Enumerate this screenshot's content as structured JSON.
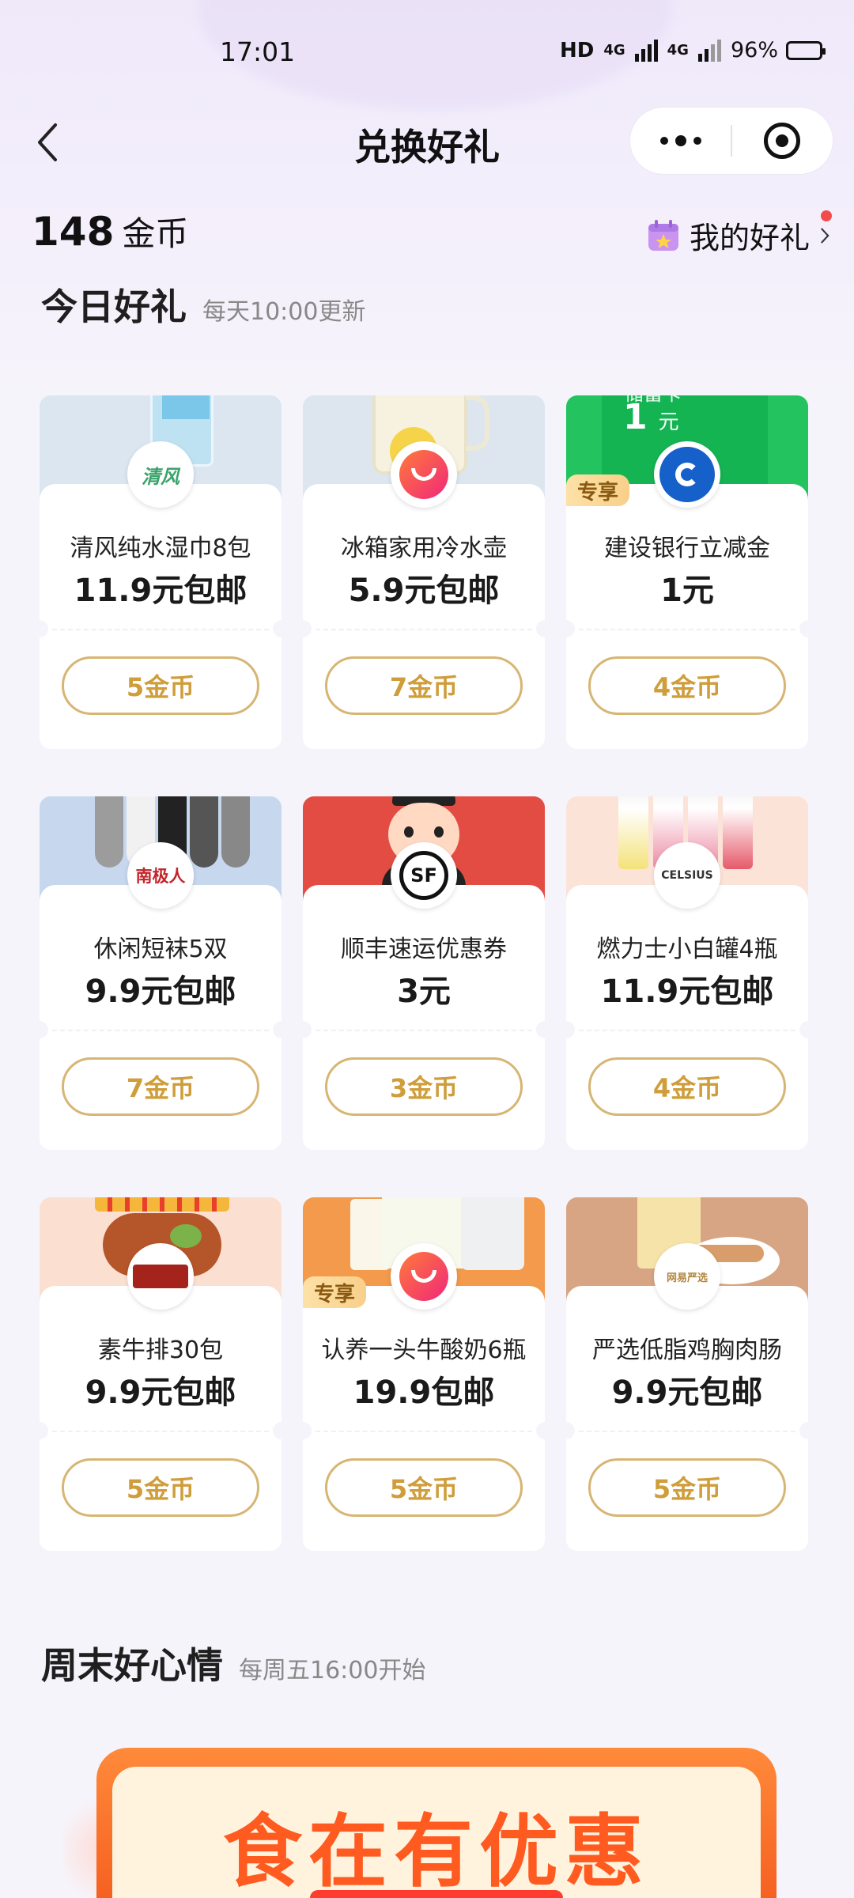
{
  "status": {
    "time": "17:01",
    "hd": "HD",
    "net1": "4G",
    "net2": "4G",
    "battery": "96%"
  },
  "nav": {
    "title": "兑换好礼"
  },
  "account": {
    "coins": "148",
    "coins_unit": "金币",
    "my_gifts": "我的好礼"
  },
  "today": {
    "title": "今日好礼",
    "subtitle": "每天10:00更新"
  },
  "items": [
    {
      "name": "清风纯水湿巾8包",
      "price": "11.9元包邮",
      "cost": "5金币",
      "brand": "清风",
      "banner_color": "#dce6f0"
    },
    {
      "name": "冰箱家用冷水壶",
      "price": "5.9元包邮",
      "cost": "7金币",
      "brand": "淘特",
      "banner_color": "#dde6ef"
    },
    {
      "name": "建设银行立减金",
      "price": "1元",
      "cost": "4金币",
      "brand": "建设银行",
      "tag": "专享",
      "card_label": "储蓄卡",
      "card_amount": "1",
      "card_unit": "元",
      "banner_color": "#23c35f"
    },
    {
      "name": "休闲短袜5双",
      "price": "9.9元包邮",
      "cost": "7金币",
      "brand": "南极人",
      "banner_color": "#c6d7ee"
    },
    {
      "name": "顺丰速运优惠券",
      "price": "3元",
      "cost": "3金币",
      "brand": "SF",
      "banner_color": "#e24c43"
    },
    {
      "name": "燃力士小白罐4瓶",
      "price": "11.9元包邮",
      "cost": "4金币",
      "brand": "CELSIUS",
      "banner_color": "#fbe3d8"
    },
    {
      "name": "素牛排30包",
      "price": "9.9元包邮",
      "cost": "5金币",
      "brand": "金牌牛排",
      "banner_color": "#fbe0d2"
    },
    {
      "name": "认养一头牛酸奶6瓶",
      "price": "19.9包邮",
      "cost": "5金币",
      "brand": "淘特",
      "tag": "专享",
      "banner_color": "#f39a4c"
    },
    {
      "name": "严选低脂鸡胸肉肠",
      "price": "9.9元包邮",
      "cost": "5金币",
      "brand": "网易严选",
      "banner_color": "#d7a583"
    }
  ],
  "weekend": {
    "title": "周末好心情",
    "subtitle": "每周五16:00开始",
    "banner_text": "食在有优惠"
  }
}
